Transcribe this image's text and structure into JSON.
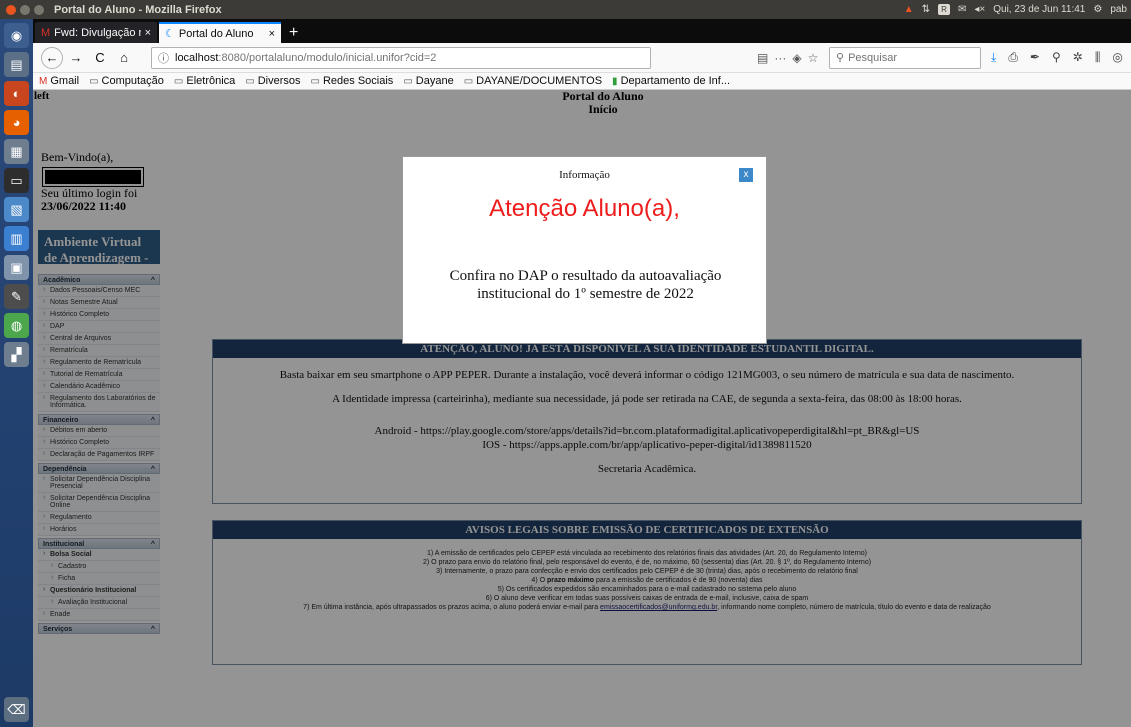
{
  "os_panel": {
    "window_title": "Portal do Aluno - Mozilla Firefox",
    "datetime": "Qui, 23 de Jun 11:41",
    "user": "pab",
    "tray_box_label": "R"
  },
  "browser": {
    "tabs": [
      {
        "label": "Fwd: Divulgação resultad",
        "icon": "gmail-icon",
        "active": false
      },
      {
        "label": "Portal do Aluno",
        "icon": "loading-icon",
        "active": true
      }
    ],
    "new_tab_label": "+",
    "url": {
      "host": "localhost",
      "rest": ":8080/portalaluno/modulo/inicial.unifor?cid=2"
    },
    "page_actions": "···",
    "search_placeholder": "Pesquisar",
    "bookmarks": [
      {
        "label": "Gmail",
        "icon": "gmail-icon"
      },
      {
        "label": "Computação",
        "icon": "folder-icon"
      },
      {
        "label": "Eletrônica",
        "icon": "folder-icon"
      },
      {
        "label": "Diversos",
        "icon": "folder-icon"
      },
      {
        "label": "Redes Sociais",
        "icon": "folder-icon"
      },
      {
        "label": "Dayane",
        "icon": "folder-icon"
      },
      {
        "label": "DAYANE/DOCUMENTOS",
        "icon": "folder-icon"
      },
      {
        "label": "Departamento de Inf...",
        "icon": "flag-icon"
      }
    ]
  },
  "page": {
    "left_label": "left",
    "title_line1": "Portal do Aluno",
    "title_line2": "Início",
    "welcome": "Bem-Vindo(a),",
    "last_login_label": "Seu último login foi",
    "last_login_date": "23/06/2022 11:40",
    "ava_label": "Ambiente Virtual de Aprendizagem - AVA"
  },
  "menu": {
    "academico": {
      "title": "Acadêmico",
      "items": [
        "Dados Pessoais/Censo MEC",
        "Notas Semestre Atual",
        "Histórico Completo",
        "DAP",
        "Central de Arquivos",
        "Rematrícula",
        "Regulamento de Rematrícula",
        "Tutorial de Rematrícula",
        "Calendário Acadêmico",
        "Regulamento dos Laboratórios de Informática."
      ]
    },
    "financeiro": {
      "title": "Financeiro",
      "items": [
        "Débitos em aberto",
        "Histórico Completo",
        "Declaração de Pagamentos IRPF"
      ]
    },
    "dependencia": {
      "title": "Dependência",
      "items": [
        "Solicitar Dependência Disciplina Presencial",
        "Solicitar Dependência Disciplina Online",
        "Regulamento",
        "Horários"
      ]
    },
    "institucional": {
      "title": "Institucional",
      "bolsa": "Bolsa Social",
      "cadastro": "Cadastro",
      "ficha": "Ficha",
      "questionario": "Questionário Institucional",
      "avaliacao": "Avaliação Institucional",
      "enade": "Enade"
    },
    "servicos": {
      "title": "Serviços"
    },
    "collapse_glyph": "^"
  },
  "panel1": {
    "header": "ATENÇÃO, ALUNO! JÁ ESTÁ DISPONÍVEL A SUA IDENTIDADE ESTUDANTIL DIGITAL.",
    "p1": "Basta baixar em seu smartphone o APP PEPER. Durante a instalação, você deverá informar o código 121MG003, o seu número de matrícula e sua data de nascimento.",
    "p2": "A Identidade impressa (carteirinha), mediante sua necessidade, já pode ser retirada na CAE, de segunda a sexta-feira, das 08:00 às 18:00 horas.",
    "android": "Android - https://play.google.com/store/apps/details?id=br.com.plataformadigital.aplicativopeperdigital&hl=pt_BR&gl=US",
    "ios": "IOS - https://apps.apple.com/br/app/aplicativo-peper-digital/id1389811520",
    "signature": "Secretaria Acadêmica."
  },
  "panel2": {
    "header": "AVISOS LEGAIS SOBRE EMISSÃO DE CERTIFICADOS DE EXTENSÃO",
    "l1": "1) A emissão de certificados pelo CEPEP está vinculada ao recebimento dos relatórios finais das atividades (Art. 20, do Regulamento Interno)",
    "l2": "2) O prazo para envio do relatório final, pelo responsável do evento, é de, no máximo, 60 (sessenta) dias (Art. 20. § 1º, do Regulamento Interno)",
    "l3": "3) Internamente, o prazo para confecção e envio dos certificados pelo CEPEP é de 30 (trinta) dias, após o recebimento do relatório final",
    "l4_pre": "4) O ",
    "l4_bold": "prazo máximo",
    "l4_post": " para a emissão de certificados é de 90 (noventa) dias",
    "l5": "5) Os certificados expedidos são encaminhados para o e-mail cadastrado no sistema pelo aluno",
    "l6": "6) O aluno deve verificar em todas suas possíveis caixas de entrada de e-mail, inclusive, caixa de spam",
    "l7_pre": "7) Em última instância, após ultrapassados os prazos acima, o aluno poderá enviar e-mail para ",
    "l7_link": "emissaocertificados@uniformg.edu.br",
    "l7_post": ", informando nome completo, número de matrícula, título do evento e data de realização"
  },
  "modal": {
    "title": "Informação",
    "close_label": "x",
    "heading": "Atenção Aluno(a),",
    "message": "Confira no DAP o resultado da autoavaliação institucional do 1º semestre de 2022",
    "heading_color": "#ee1c1c"
  }
}
